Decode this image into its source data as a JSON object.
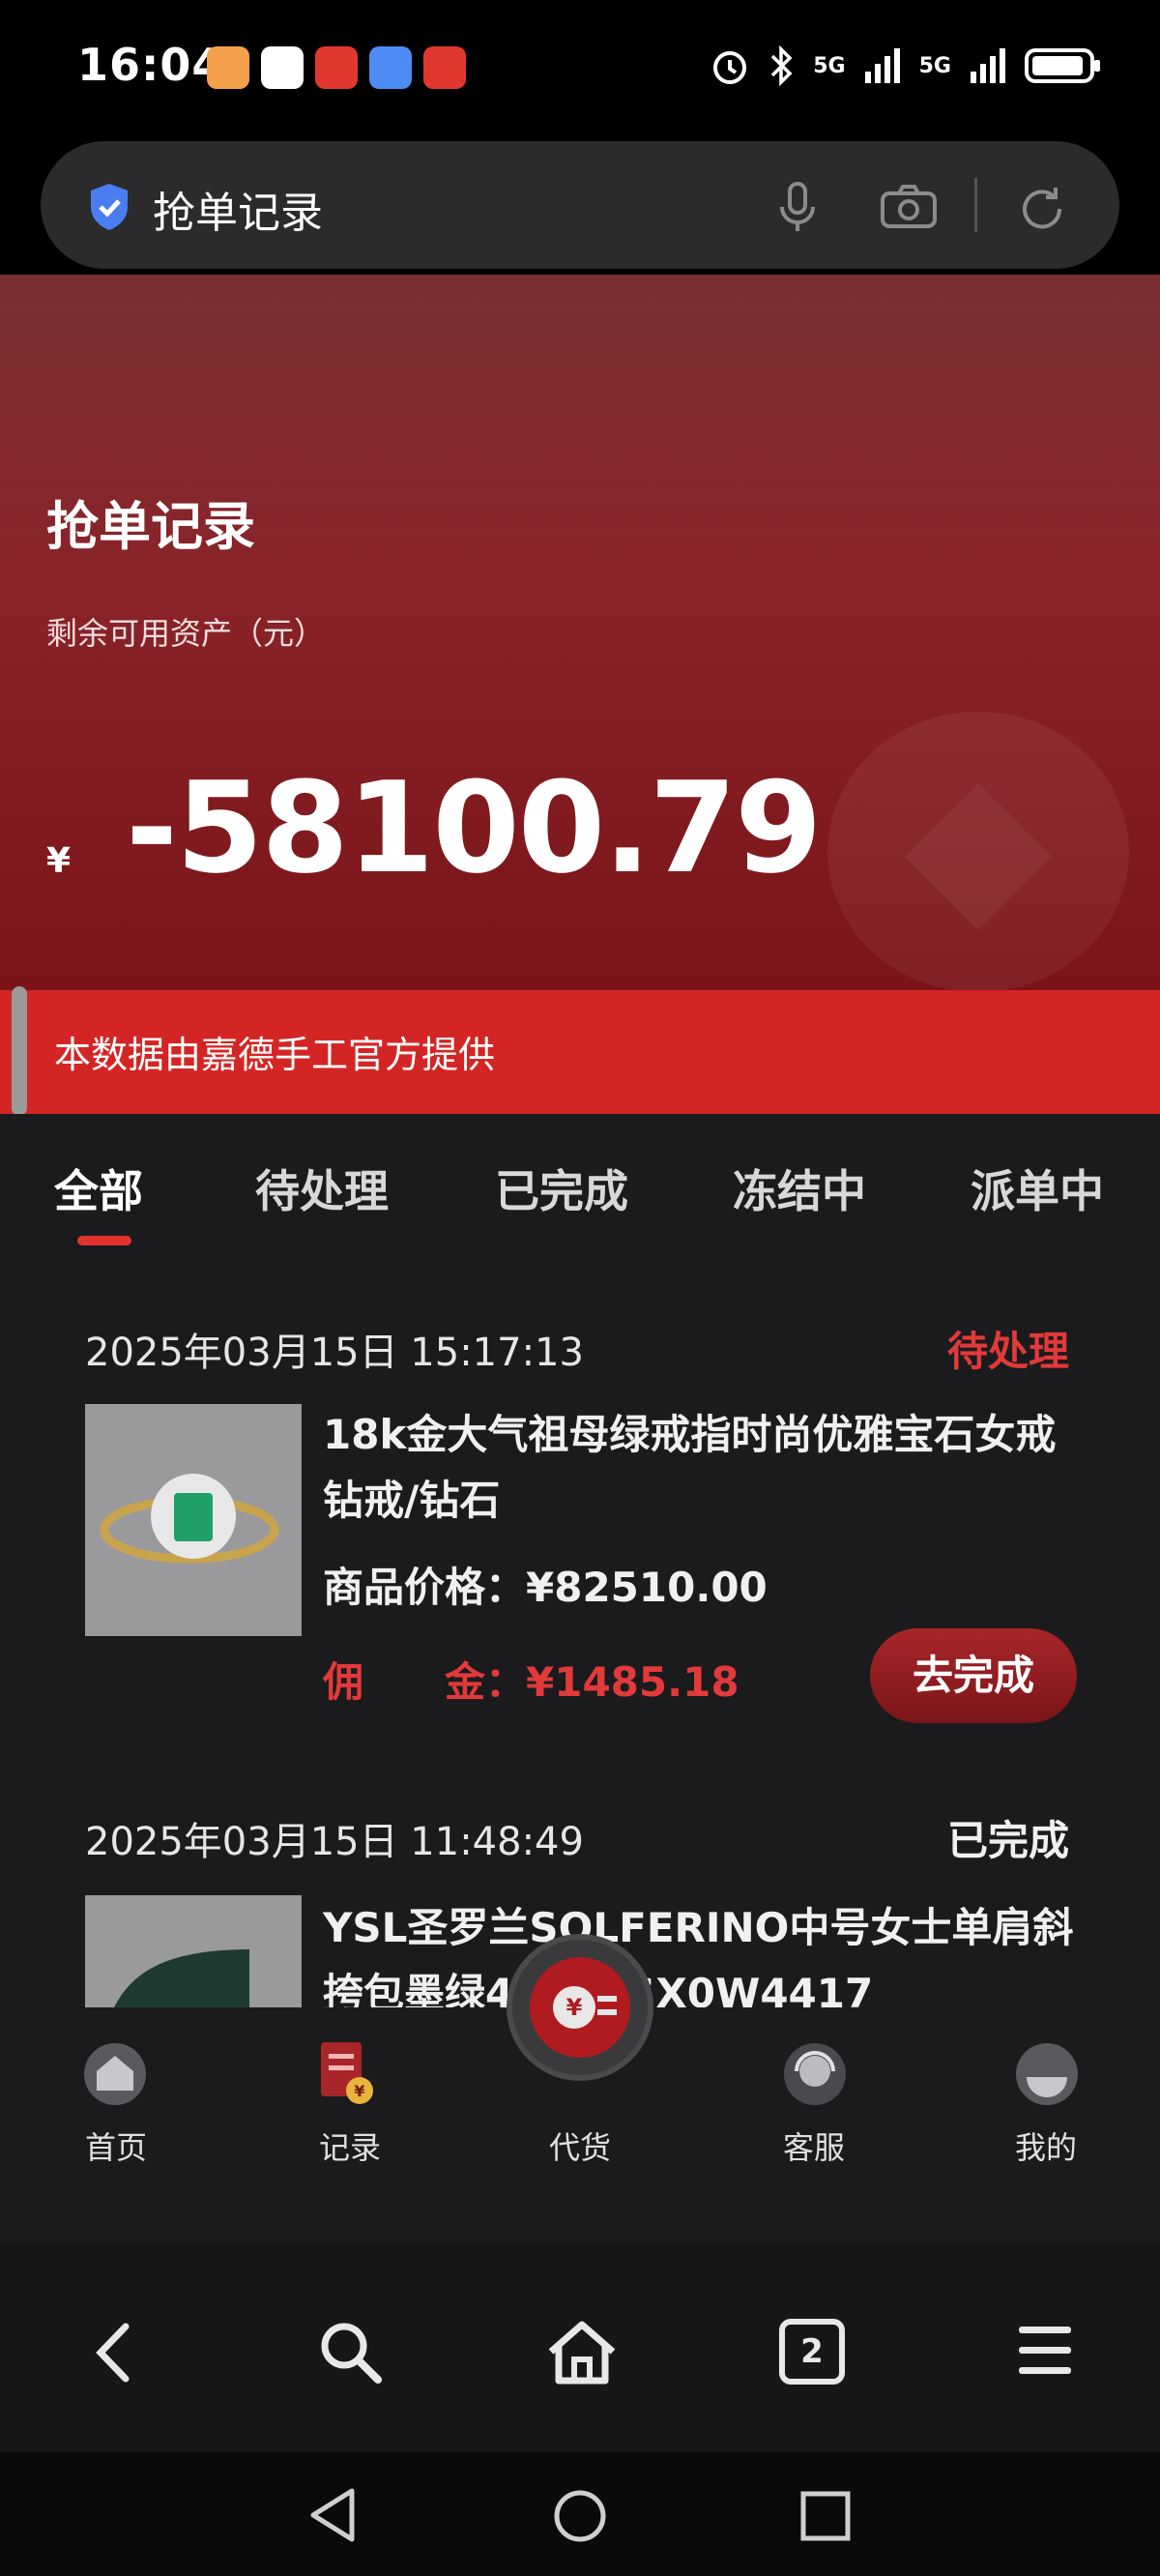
{
  "status_bar": {
    "time": "16:04",
    "signal_1": "5G",
    "signal_2": "5G",
    "icons": [
      "alarm-icon",
      "bluetooth-icon",
      "signal-icon",
      "signal-icon",
      "battery-icon"
    ]
  },
  "browser": {
    "url_title": "抢单记录"
  },
  "hero": {
    "title": "抢单记录",
    "subtitle": "剩余可用资产（元）",
    "currency": "¥",
    "amount": "-58100.79"
  },
  "notice": {
    "text": "本数据由嘉德手工官方提供"
  },
  "tabs": [
    {
      "label": "全部",
      "active": true
    },
    {
      "label": "待处理",
      "active": false
    },
    {
      "label": "已完成",
      "active": false
    },
    {
      "label": "冻结中",
      "active": false
    },
    {
      "label": "派单中",
      "active": false
    }
  ],
  "orders": [
    {
      "time": "2025年03月15日 15:17:13",
      "status": "待处理",
      "status_color": "#e2393a",
      "title": "18k金大气祖母绿戒指时尚优雅宝石女戒钻戒/钻石",
      "price_label": "商品价格：",
      "price": "¥82510.00",
      "commission_label": "佣　　金：",
      "commission": "¥1485.18",
      "button": "去完成"
    },
    {
      "time": "2025年03月15日 11:48:49",
      "status": "已完成",
      "status_color": "#f0f0f0",
      "title": "YSL圣罗兰SOLFERINO中号女士单肩斜挎包墨绿",
      "title_tail": "43050SX0W4417"
    }
  ],
  "bottom_nav": {
    "items": [
      {
        "label": "首页",
        "icon": "home-icon"
      },
      {
        "label": "记录",
        "icon": "record-icon"
      },
      {
        "label": "代货",
        "icon": "goods-icon"
      },
      {
        "label": "客服",
        "icon": "support-icon"
      },
      {
        "label": "我的",
        "icon": "profile-icon"
      }
    ]
  },
  "browser_bar": {
    "tab_count": "2",
    "icons": [
      "back-icon",
      "search-icon",
      "home-icon",
      "tabs-icon",
      "menu-icon"
    ]
  },
  "system_nav": {
    "icons": [
      "back-triangle-icon",
      "home-circle-icon",
      "recents-square-icon"
    ]
  },
  "colors": {
    "hero_top": "#7a2f33",
    "accent_red": "#d42525",
    "commission_red": "#e2393a",
    "page_bg": "#1b1b1d"
  }
}
